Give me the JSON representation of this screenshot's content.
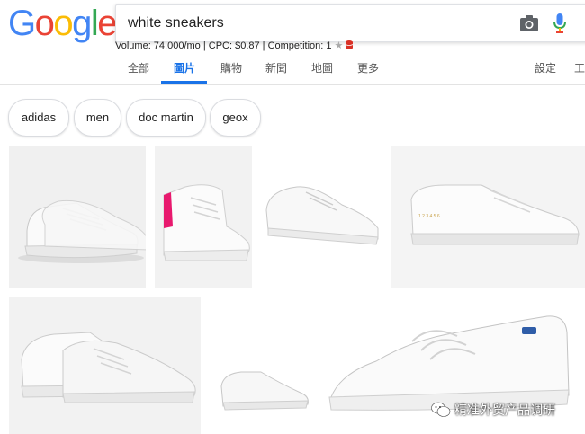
{
  "header": {
    "logo_letters": [
      "G",
      "o",
      "o",
      "g",
      "l",
      "e"
    ],
    "logo_colors": [
      "#4285F4",
      "#EA4335",
      "#FBBC05",
      "#4285F4",
      "#34A853",
      "#EA4335"
    ],
    "search_query": "white sneakers",
    "camera_icon": "camera-icon",
    "mic_icon": "microphone-icon"
  },
  "seo_bar": {
    "text": "Volume: 74,000/mo | CPC: $0.87 | Competition: 1",
    "star_icon": "★",
    "db_icon": "database-icon"
  },
  "tabs": [
    {
      "label": "全部",
      "active": false
    },
    {
      "label": "圖片",
      "active": true
    },
    {
      "label": "購物",
      "active": false
    },
    {
      "label": "新聞",
      "active": false
    },
    {
      "label": "地圖",
      "active": false
    },
    {
      "label": "更多",
      "active": false
    }
  ],
  "settings_label": "設定",
  "tools_label": "工",
  "chips": [
    "adidas",
    "men",
    "doc martin",
    "geox"
  ],
  "colors": {
    "accent": "#1a73e8",
    "sneaker_heel_pink": "#e8196e"
  },
  "watermark": {
    "text": "精准外贸产品调研",
    "icon": "wechat-icon"
  }
}
